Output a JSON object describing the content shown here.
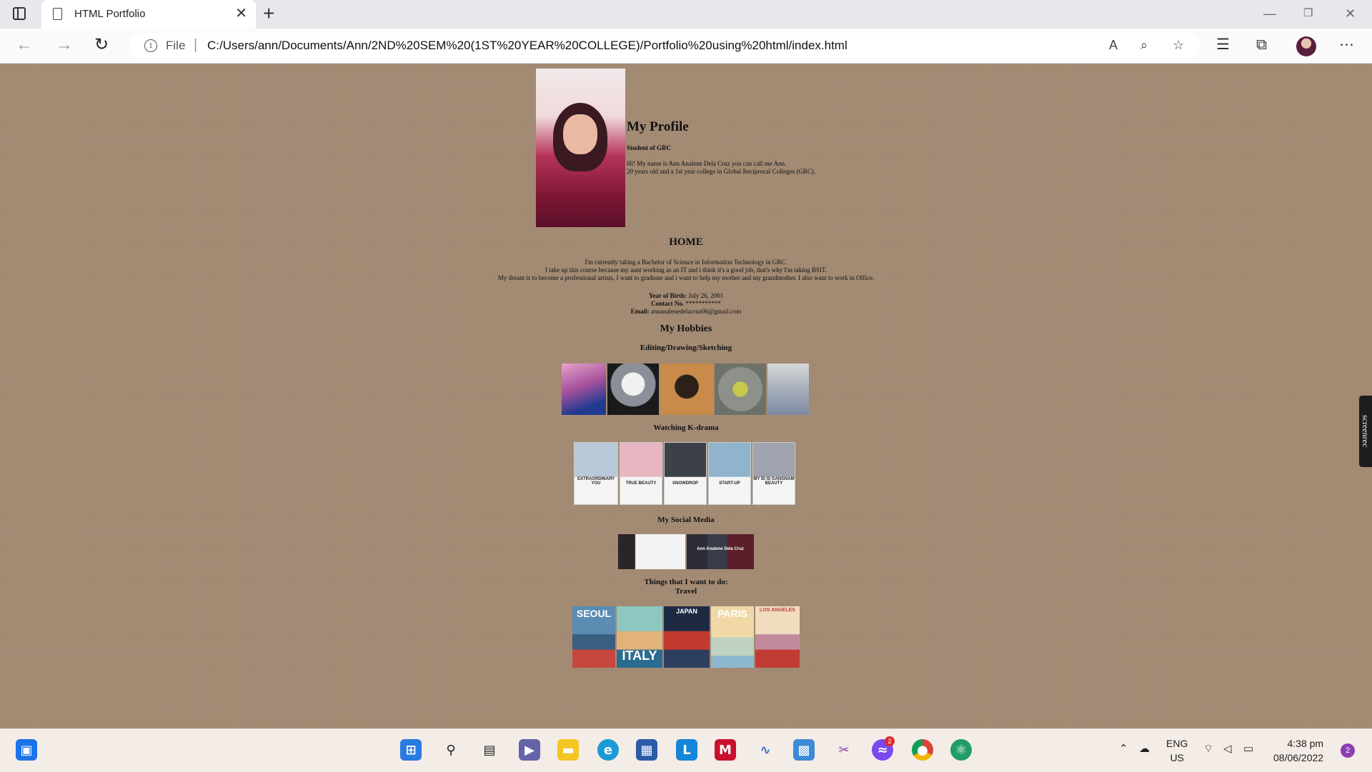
{
  "browser": {
    "tab_title": "HTML Portfolio",
    "address_prefix": "File",
    "url": "C:/Users/ann/Documents/Ann/2ND%20SEM%20(1ST%20YEAR%20COLLEGE)/Portfolio%20using%20html/index.html"
  },
  "profile": {
    "title": "My Profile",
    "subtitle": "Student of GRC",
    "intro_line1": "Hi! My name is Ann Analene Dela Cruz you can call me Ann.",
    "intro_line2": "20 years old and a 1st year college in Global Reciprocal Colleges (GRC)."
  },
  "home": {
    "heading": "HOME",
    "line1": "I'm currently taking a Bachelor of Science in Information Technology in GRC.",
    "line2": "I take up this course because my aunt working as an IT and i think it's a good job, that's why I'm taking BSIT.",
    "line3": "My dream is to become a professional artists, I want to graduate and i want to help my mother and my grandmother. I also want to work in Office.",
    "birth_label": "Year of Birth:",
    "birth_value": " July 26, 2001",
    "contact_label": "Contact No.",
    "contact_value": " ***********",
    "email_label": "Email:",
    "email_value": " annanalenedelacruz06@gmail.com"
  },
  "hobbies": {
    "heading": "My Hobbies",
    "art_heading": "Editing/Drawing/Sketching",
    "kdrama_heading": "Watching K-drama",
    "posters": [
      "EXTRAORDINARY YOU",
      "TRUE BEAUTY",
      "SNOWDROP",
      "START-UP",
      "MY ID IS GANGNAM BEAUTY"
    ],
    "social_heading": "My Social Media",
    "social_name": "Ann Analene Dela Cruz",
    "todo_heading": "Things that I want to do:",
    "travel_heading": "Travel",
    "travel": [
      "SEOUL",
      "ITALY",
      "JAPAN",
      "PARIS",
      "LOS ANGELES"
    ]
  },
  "screenrec": "screenrec",
  "taskbar": {
    "lang1": "ENG",
    "lang2": "US",
    "time": "4:38 pm",
    "date": "08/06/2022",
    "notifications": "2",
    "messenger_badge": "2"
  },
  "colors": {
    "page_bg": "#a38a73",
    "taskbar_bg": "#f4ece6"
  }
}
